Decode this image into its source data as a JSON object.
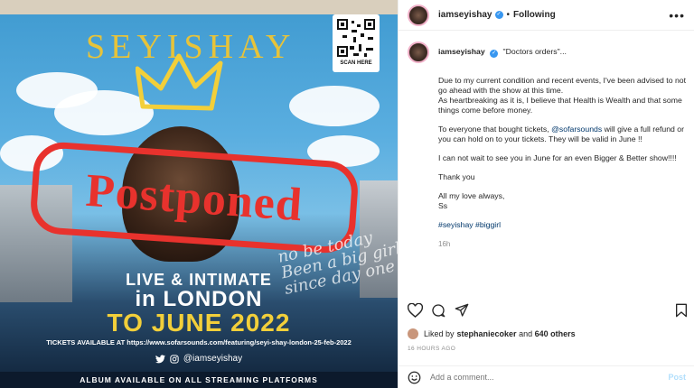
{
  "poster": {
    "brand": "SEYISHAY",
    "qr_caption": "SCAN HERE",
    "stamp": "Postponed",
    "note": "no be today Been a big girl since day one",
    "live": "LIVE & INTIMATE",
    "city": "in LONDON",
    "date": "TO JUNE 2022",
    "tickets": "TICKETS AVAILABLE AT https://www.sofarsounds.com/featuring/seyi-shay-london-25-feb-2022",
    "handle": "@iamseyishay",
    "footer": "ALBUM AVAILABLE ON ALL STREAMING PLATFORMS",
    "icons": [
      "twitter-icon",
      "instagram-icon"
    ],
    "colors": {
      "stamp": "#e8322d",
      "gold": "#e7c33a",
      "date": "#f2cf3a"
    }
  },
  "header": {
    "username": "iamseyishay",
    "separator": "•",
    "follow_state": "Following",
    "more": "•••"
  },
  "caption": {
    "username": "iamseyishay",
    "lead": "\"Doctors orders\"...",
    "p1": "Due to my current condition and recent events, I've been advised to not go ahead with the show at this time.",
    "p2": "As heartbreaking as it is, I believe that Health is Wealth and that some things come before money.",
    "p3_before": "To everyone that bought tickets, ",
    "p3_mention": "@sofarsounds",
    "p3_after": " will give a full refund or you can hold on to your tickets. They will be valid in June !!",
    "p4": "I can not wait to see you in June for an even Bigger & Better show!!!!",
    "p5": "Thank you",
    "p6a": "All my love always,",
    "p6b": "Ss",
    "hashtags": "#seyishay #biggirl",
    "time": "16h"
  },
  "likes": {
    "prefix": "Liked by ",
    "user": "stephaniecoker",
    "middle": " and ",
    "others": "640 others",
    "ago": "16 HOURS AGO"
  },
  "comment": {
    "placeholder": "Add a comment...",
    "post": "Post"
  }
}
